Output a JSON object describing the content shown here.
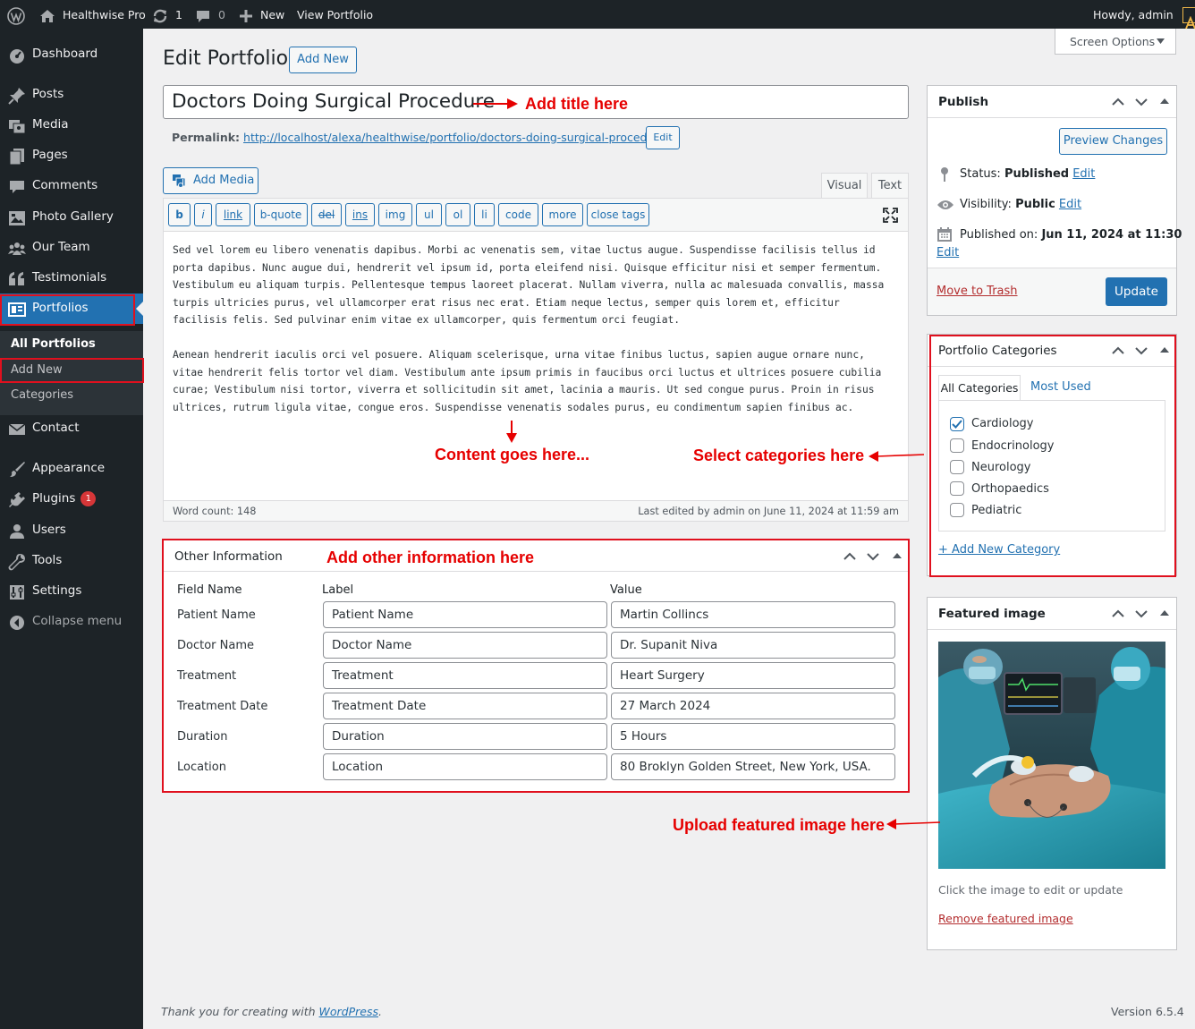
{
  "adminbar": {
    "site_name": "Healthwise Pro",
    "updates_count": "1",
    "comments_count": "0",
    "new_label": "New",
    "view_label": "View Portfolio",
    "howdy": "Howdy, admin"
  },
  "sidebar": {
    "items": [
      {
        "label": "Dashboard"
      },
      {
        "label": "Posts"
      },
      {
        "label": "Media"
      },
      {
        "label": "Pages"
      },
      {
        "label": "Comments"
      },
      {
        "label": "Photo Gallery"
      },
      {
        "label": "Our Team"
      },
      {
        "label": "Testimonials"
      },
      {
        "label": "Portfolios"
      },
      {
        "label": "Contact"
      },
      {
        "label": "Appearance"
      },
      {
        "label": "Plugins"
      },
      {
        "label": "Users"
      },
      {
        "label": "Tools"
      },
      {
        "label": "Settings"
      },
      {
        "label": "Collapse menu"
      }
    ],
    "plugins_badge": "1",
    "submenu": [
      "All Portfolios",
      "Add New",
      "Categories"
    ]
  },
  "header": {
    "screen_options": "Screen Options",
    "page_title": "Edit Portfolio",
    "add_new": "Add New"
  },
  "editor": {
    "title_value": "Doctors Doing Surgical Procedure",
    "permalink_label": "Permalink:",
    "permalink_url": "http://localhost/alexa/healthwise/portfolio/doctors-doing-surgical-procedure/",
    "permalink_edit": "Edit",
    "add_media": "Add Media",
    "tab_visual": "Visual",
    "tab_text": "Text",
    "quicktags": [
      "b",
      "i",
      "link",
      "b-quote",
      "del",
      "ins",
      "img",
      "ul",
      "ol",
      "li",
      "code",
      "more",
      "close tags"
    ],
    "paragraphs": [
      "Sed vel lorem eu libero venenatis dapibus. Morbi ac venenatis sem, vitae luctus augue. Suspendisse facilisis tellus id porta dapibus. Nunc augue dui, hendrerit vel ipsum id, porta eleifend nisi. Quisque efficitur nisi et semper fermentum. Vestibulum eu aliquam turpis. Pellentesque tempus laoreet placerat. Nullam viverra, nulla ac malesuada convallis, massa turpis ultricies purus, vel ullamcorper erat risus nec erat. Etiam neque lectus, semper quis lorem et, efficitur facilisis felis. Sed pulvinar enim vitae ex ullamcorper, quis fermentum orci feugiat.",
      "Aenean hendrerit iaculis orci vel posuere. Aliquam scelerisque, urna vitae finibus luctus, sapien augue ornare nunc, vitae hendrerit felis tortor vel diam. Vestibulum ante ipsum primis in faucibus orci luctus et ultrices posuere cubilia curae; Vestibulum nisi tortor, viverra et sollicitudin sit amet, lacinia a mauris. Ut sed congue purus. Proin in risus ultrices, rutrum ligula vitae, congue eros. Suspendisse venenatis sodales purus, eu condimentum sapien finibus ac."
    ],
    "word_count": "Word count: 148",
    "last_edited": "Last edited by admin on June 11, 2024 at 11:59 am"
  },
  "other_info": {
    "title": "Other Information",
    "col_field": "Field Name",
    "col_label": "Label",
    "col_value": "Value",
    "rows": [
      {
        "field": "Patient Name",
        "label": "Patient Name",
        "value": "Martin Collincs"
      },
      {
        "field": "Doctor Name",
        "label": "Doctor Name",
        "value": "Dr. Supanit Niva"
      },
      {
        "field": "Treatment",
        "label": "Treatment",
        "value": "Heart Surgery"
      },
      {
        "field": "Treatment Date",
        "label": "Treatment Date",
        "value": "27 March 2024"
      },
      {
        "field": "Duration",
        "label": "Duration",
        "value": "5 Hours"
      },
      {
        "field": "Location",
        "label": "Location",
        "value": "80 Broklyn Golden Street, New York, USA."
      }
    ]
  },
  "publish": {
    "title": "Publish",
    "preview": "Preview Changes",
    "status_label": "Status:",
    "status_value": "Published",
    "visibility_label": "Visibility:",
    "visibility_value": "Public",
    "published_label": "Published on:",
    "published_value": "Jun 11, 2024 at 11:30",
    "edit": "Edit",
    "trash": "Move to Trash",
    "update": "Update"
  },
  "categories": {
    "title": "Portfolio Categories",
    "tab_all": "All Categories",
    "tab_used": "Most Used",
    "items": [
      {
        "name": "Cardiology",
        "checked": true
      },
      {
        "name": "Endocrinology",
        "checked": false
      },
      {
        "name": "Neurology",
        "checked": false
      },
      {
        "name": "Orthopaedics",
        "checked": false
      },
      {
        "name": "Pediatric",
        "checked": false
      }
    ],
    "add_new": "+ Add New Category"
  },
  "featured": {
    "title": "Featured image",
    "hint": "Click the image to edit or update",
    "remove": "Remove featured image"
  },
  "annotations": {
    "title": "Add title here",
    "content": "Content goes here...",
    "categories": "Select categories here",
    "other": "Add other information here",
    "image": "Upload featured image here"
  },
  "footer": {
    "thanks_prefix": "Thank you for creating with ",
    "thanks_link": "WordPress",
    "thanks_suffix": ".",
    "version": "Version 6.5.4"
  },
  "colors": {
    "accent": "#2271b1",
    "sidebar_bg": "#1d2327",
    "annotation_red": "#e60000",
    "danger": "#b32d2e"
  }
}
